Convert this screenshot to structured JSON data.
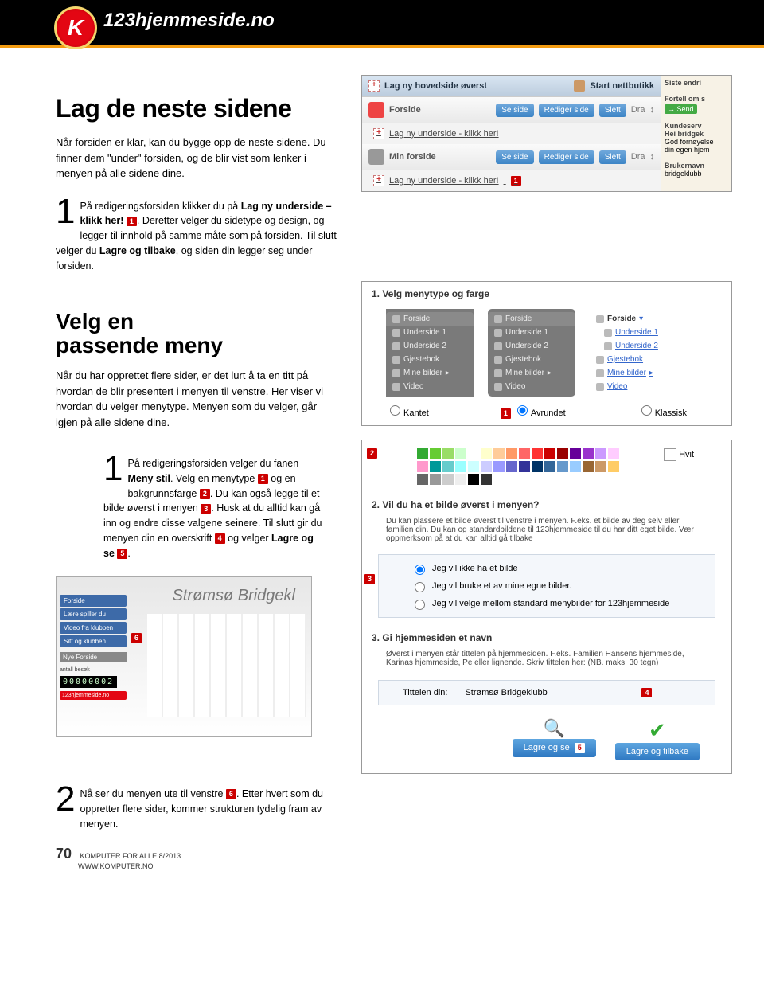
{
  "brand": "123hjemmeside.no",
  "h1": "Lag de neste sidene",
  "intro": "Når forsiden er klar, kan du bygge opp de neste sidene. Du finner dem \"under\" forsiden, og de blir vist som lenker i menyen på alle sidene dine.",
  "step1_a": "På redigeringsforsiden klikker du på ",
  "step1_b": "Lag ny underside – klikk her!",
  "step1_c": ". Deretter velger du sidetype og design, og legger til innhold på samme måte som på forsiden. Til slutt velger du ",
  "step1_d": "Lagre og tilbake",
  "step1_e": ", og siden din legger seg under forsiden.",
  "panel": {
    "top_btn1": "Lag ny hovedside øverst",
    "top_btn2": "Start nettbutikk",
    "row1_label": "Forside",
    "row2_label": "Min forside",
    "link": "Lag ny underside - klikk her!",
    "btns": {
      "se": "Se side",
      "rediger": "Rediger side",
      "slett": "Slett",
      "dra": "Dra"
    },
    "side_top": "Siste endri",
    "side_fortell": "Fortell om s",
    "side_send": "Send",
    "side_kunde": "Kundeserv",
    "side_hei": "Hei bridgek",
    "side_god": "God fornøyelse",
    "side_din": "din egen hjem",
    "side_bruker": "Brukernavn",
    "side_bridge": "bridgeklubb"
  },
  "h2": "Velg en\npassende meny",
  "intro2": "Når du har opprettet flere sider, er det lurt å ta en titt på hvordan de blir presentert i menyen til venstre. Her viser vi hvordan du velger menytype. Menyen som du velger, går igjen på alle sidene dine.",
  "menu_step_a": "På redigeringsforsiden velger du fanen ",
  "menu_step_b": "Meny stil",
  "menu_step_c": ". Velg en menytype ",
  "menu_step_d": " og en bakgrunnsfarge ",
  "menu_step_e": ". Du kan også legge til et bilde øverst i menyen ",
  "menu_step_f": ". Husk at du alltid kan gå inn og endre disse valgene seinere. Til slutt gir du menyen din en overskrift ",
  "menu_step_g": " og velger ",
  "menu_step_h": "Lagre og se",
  "menu_step_i": ".",
  "menupanel": {
    "sec1": "1. Velg menytype og farge",
    "items": [
      "Forside",
      "Underside 1",
      "Underside 2",
      "Gjestebok",
      "Mine bilder",
      "Video"
    ],
    "r1": "Kantet",
    "r2": "Avrundet",
    "r3": "Klassisk",
    "hvit": "Hvit",
    "sec2": "2. Vil du ha et bilde øverst i menyen?",
    "sec2_text": "Du kan plassere et bilde øverst til venstre i menyen. F.eks. et bilde av deg selv eller familien din. Du kan og standardbildene til 123hjemmeside til du har ditt eget bilde. Vær oppmerksom på at du kan alltid gå tilbake",
    "opt1": "Jeg vil ikke ha et bilde",
    "opt2": "Jeg vil bruke et av mine egne bilder.",
    "opt3": "Jeg vil velge mellom standard menybilder for 123hjemmeside",
    "sec3": "3. Gi hjemmesiden et navn",
    "sec3_text": "Øverst i menyen står tittelen på hjemmesiden. F.eks. Familien Hansens hjemmeside, Karinas hjemmeside, Pe eller lignende. Skriv tittelen her: (NB. maks. 30 tegn)",
    "title_label": "Tittelen din:",
    "title_value": "Strømsø Bridgeklubb",
    "btn_se": "Lagre og se",
    "btn_tilbake": "Lagre og tilbake"
  },
  "preview": {
    "title": "Strømsø Bridgekl",
    "b1": "Forside",
    "b2": "Lære spiller du",
    "b3": "Video fra klubben",
    "b4": "Sitt og klubben",
    "bottom": "Nye Forside",
    "label": "antall besøk",
    "counter": "00000002",
    "ad": "123hjemmeside.no"
  },
  "step2_a": "Nå ser du menyen ute til venstre ",
  "step2_b": ". Etter hvert som du oppretter flere sider, kommer strukturen tydelig fram av menyen.",
  "footer": {
    "page": "70",
    "mag": "KOMPUTER FOR ALLE 8/2013",
    "url": "WWW.KOMPUTER.NO"
  },
  "swatch_colors": [
    "#3a3",
    "#6c3",
    "#9d6",
    "#cfc",
    "#fff",
    "#ffc",
    "#fc9",
    "#f96",
    "#f66",
    "#f33",
    "#c00",
    "#900",
    "#609",
    "#93c",
    "#c9f",
    "#fcf",
    "#f9c",
    "#099",
    "#6cc",
    "#9ff",
    "#cff",
    "#ccf",
    "#99f",
    "#66c",
    "#339",
    "#036",
    "#369",
    "#69c",
    "#9cf",
    "#963",
    "#c96",
    "#fc6",
    "#666",
    "#999",
    "#ccc",
    "#eee",
    "#000",
    "#333"
  ]
}
